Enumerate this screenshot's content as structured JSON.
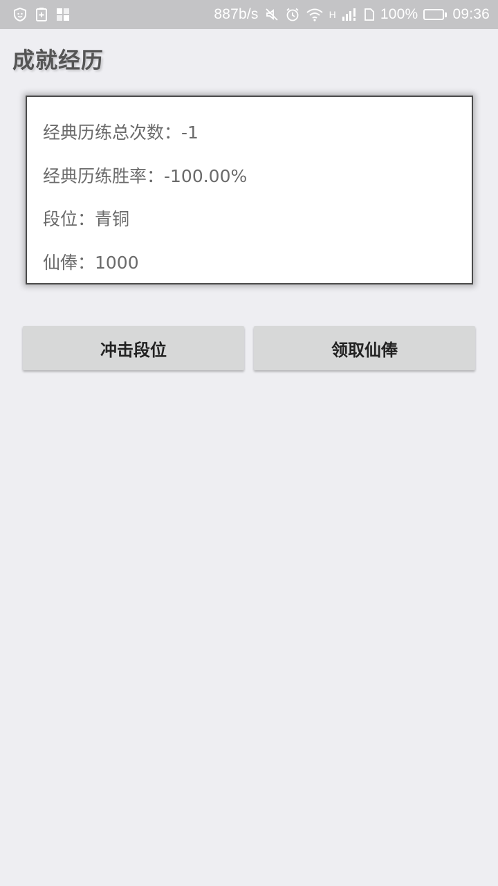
{
  "status_bar": {
    "network_speed": "887b/s",
    "network_type": "H",
    "battery_percent": "100%",
    "battery_level": 1.0,
    "time": "09:36",
    "battery_color": "#f7a21b",
    "icons": [
      "shield-icon",
      "battery-saver-icon",
      "grid-app-icon",
      "mute-icon",
      "alarm-icon",
      "wifi-icon",
      "signal-icon",
      "sim-card-icon",
      "battery-icon"
    ]
  },
  "page": {
    "title": "成就经历"
  },
  "stats": {
    "total_battles": "经典历练总次数：-1",
    "win_rate": "经典历练胜率：-100.00%",
    "rank": "段位：青铜",
    "salary": "仙俸：1000"
  },
  "actions": {
    "rank_up_label": "冲击段位",
    "claim_salary_label": "领取仙俸"
  }
}
